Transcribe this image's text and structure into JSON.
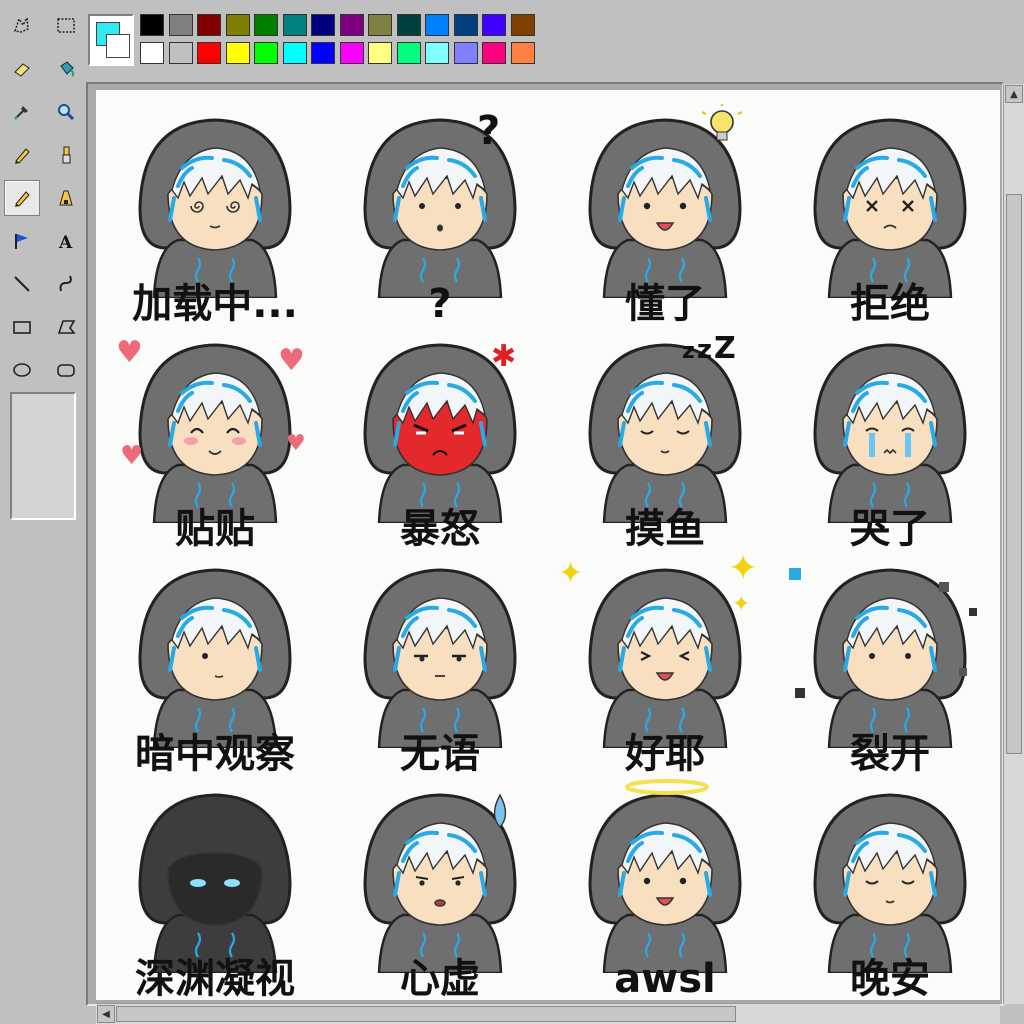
{
  "app": {
    "name": "Paint"
  },
  "toolbox": {
    "tools": [
      {
        "id": "free-select",
        "icon": "free-select-icon"
      },
      {
        "id": "rect-select",
        "icon": "rect-select-icon"
      },
      {
        "id": "eraser",
        "icon": "eraser-icon"
      },
      {
        "id": "fill",
        "icon": "fill-bucket-icon"
      },
      {
        "id": "color-picker",
        "icon": "color-picker-icon"
      },
      {
        "id": "magnifier",
        "icon": "magnifier-icon"
      },
      {
        "id": "pencil",
        "icon": "pencil-icon"
      },
      {
        "id": "brush",
        "icon": "brush-icon"
      },
      {
        "id": "pencil-active",
        "icon": "pencil-icon",
        "active": true
      },
      {
        "id": "airbrush",
        "icon": "airbrush-icon"
      },
      {
        "id": "flag",
        "icon": "flag-icon"
      },
      {
        "id": "text",
        "icon": "text-icon",
        "glyph": "A"
      },
      {
        "id": "line",
        "icon": "line-icon"
      },
      {
        "id": "curve",
        "icon": "curve-icon"
      },
      {
        "id": "rectangle",
        "icon": "rectangle-icon"
      },
      {
        "id": "polygon",
        "icon": "polygon-icon"
      },
      {
        "id": "ellipse",
        "icon": "ellipse-icon"
      },
      {
        "id": "rounded-rect",
        "icon": "rounded-rectangle-icon"
      }
    ]
  },
  "palette": {
    "foreground": "#33e8f0",
    "background": "#ffffff",
    "top_row": [
      "#000000",
      "#808080",
      "#800000",
      "#808000",
      "#008000",
      "#008080",
      "#000080",
      "#800080",
      "#808040",
      "#004040",
      "#0080ff",
      "#004080",
      "#4000ff",
      "#804000"
    ],
    "bottom_row": [
      "#ffffff",
      "#c0c0c0",
      "#ff0000",
      "#ffff00",
      "#00ff00",
      "#00ffff",
      "#0000ff",
      "#ff00ff",
      "#ffff80",
      "#00ff80",
      "#80ffff",
      "#8080ff",
      "#ff0080",
      "#ff8040"
    ]
  },
  "stickers": [
    {
      "label": "加载中...",
      "mood": "dizzy",
      "deco": ""
    },
    {
      "label": "?",
      "mood": "confused",
      "deco": "?"
    },
    {
      "label": "懂了",
      "mood": "idea",
      "deco": "bulb"
    },
    {
      "label": "拒绝",
      "mood": "refuse",
      "deco": ""
    },
    {
      "label": "贴贴",
      "mood": "love",
      "deco": "hearts"
    },
    {
      "label": "暴怒",
      "mood": "angry",
      "deco": "anger"
    },
    {
      "label": "摸鱼",
      "mood": "sleep",
      "deco": "zzz"
    },
    {
      "label": "哭了",
      "mood": "cry",
      "deco": ""
    },
    {
      "label": "暗中观察",
      "mood": "peek",
      "deco": ""
    },
    {
      "label": "无语",
      "mood": "speechless",
      "deco": ""
    },
    {
      "label": "好耶",
      "mood": "happy",
      "deco": "sparkles"
    },
    {
      "label": "裂开",
      "mood": "broken",
      "deco": "pixels"
    },
    {
      "label": "深渊凝视",
      "mood": "dark",
      "deco": ""
    },
    {
      "label": "心虚",
      "mood": "nervous",
      "deco": "sweat"
    },
    {
      "label": "awsl",
      "mood": "angel",
      "deco": "halo"
    },
    {
      "label": "晚安",
      "mood": "goodnight",
      "deco": ""
    }
  ],
  "colors": {
    "hood": "#6f6f6f",
    "hood_dark": "#4a4a4a",
    "hair": "#f2f6f8",
    "hair_accent": "#29a9e6",
    "skin": "#f8dfc0"
  }
}
